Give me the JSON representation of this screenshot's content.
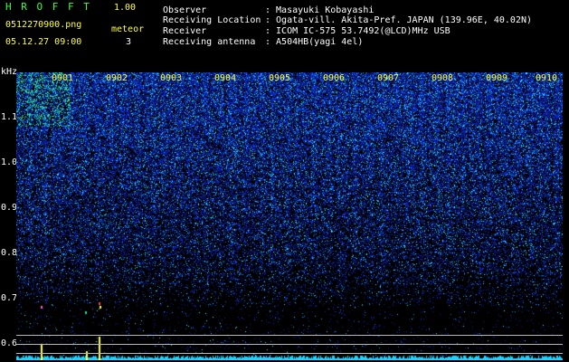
{
  "header": {
    "app_title": "H R O F F T",
    "version": "1.00",
    "filename": "0512270900.png",
    "datetime": "05.12.27 09:00",
    "meteor_label": "meteor",
    "meteor_count": "3"
  },
  "info": {
    "rows": [
      {
        "label": "Observer",
        "value": ": Masayuki Kobayashi"
      },
      {
        "label": "Receiving Location",
        "value": ": Ogata-vill. Akita-Pref. JAPAN (139.96E, 40.02N)"
      },
      {
        "label": "Receiver",
        "value": ": ICOM IC-575 53.7492(@LCD)MHz USB"
      },
      {
        "label": "Receiving antenna",
        "value": ": A504HB(yagi 4el)"
      }
    ]
  },
  "y_axis": {
    "unit": "kHz",
    "ticks": [
      "1.1",
      "1.0",
      "0.9",
      "0.8",
      "0.7",
      "0.6"
    ]
  },
  "x_axis": {
    "ticks": [
      "0901",
      "0902",
      "0903",
      "0904",
      "0905",
      "0906",
      "0907",
      "0908",
      "0909",
      "0910"
    ]
  },
  "colors": {
    "title": "#3cff3c",
    "text_yellow": "#ffff40",
    "text_white": "#ffffff",
    "spectrum_blue": "#1020c0",
    "spectrum_cyan": "#20c8ff"
  }
}
